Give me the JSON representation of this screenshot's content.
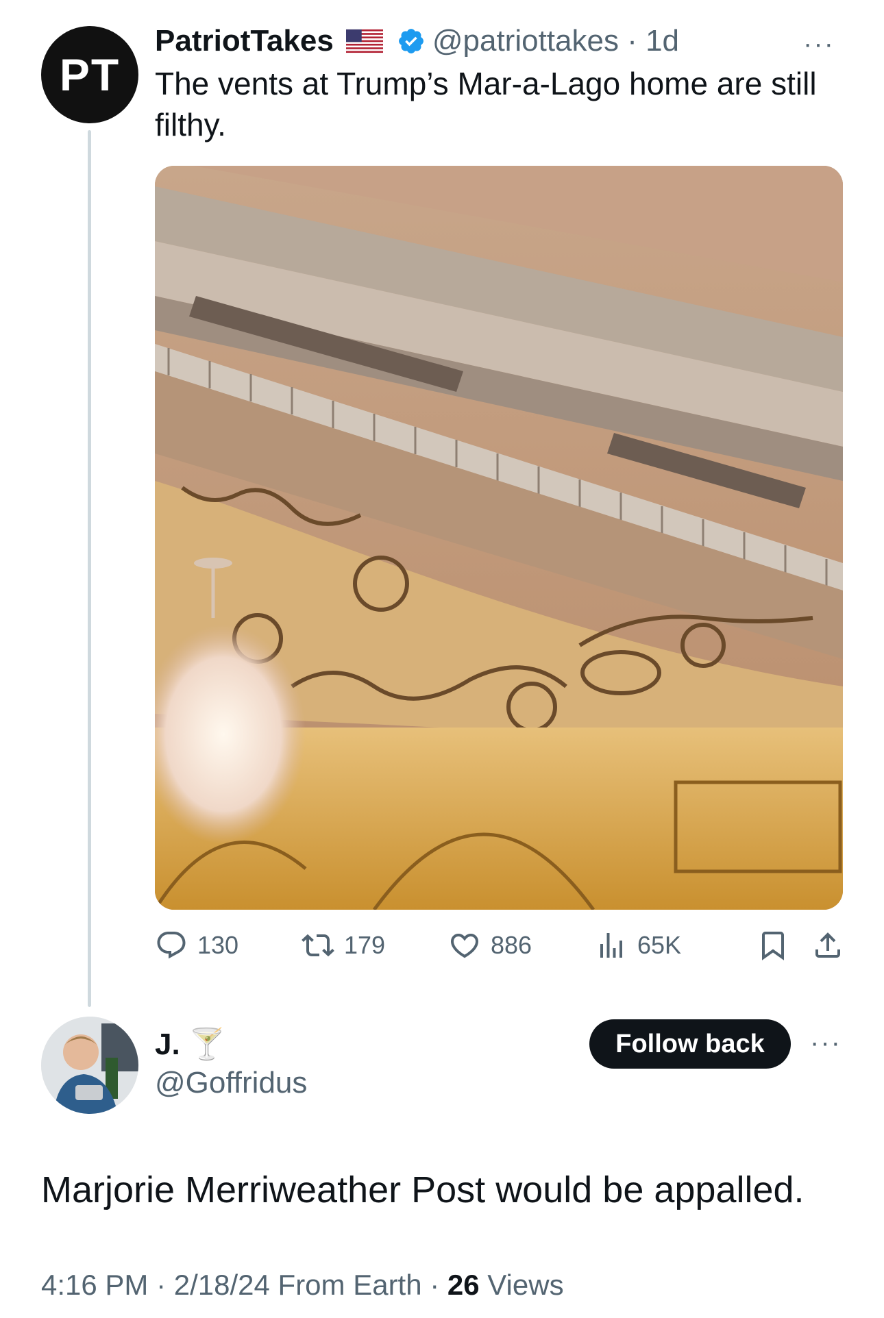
{
  "original_tweet": {
    "avatar_initials": "PT",
    "display_name": "PatriotTakes",
    "flag_icon": "us-flag-icon",
    "verified_icon": "verified-badge-icon",
    "verified_color": "#1d9bf0",
    "handle_time": "@patriottakes · 1d",
    "more_label": "···",
    "text": "The vents at Trump’s Mar-a-Lago home are still filthy.",
    "actions": {
      "replies": "130",
      "reposts": "179",
      "likes": "886",
      "views": "65K"
    }
  },
  "reply": {
    "display_name": "J. 🍸",
    "handle": "@Goffridus",
    "follow_button": "Follow back",
    "more_label": "···",
    "text": "Marjorie Merriweather Post would be appalled.",
    "meta_prefix": "4:16 PM · 2/18/24 From Earth · ",
    "views_count": "26",
    "views_label": " Views"
  }
}
